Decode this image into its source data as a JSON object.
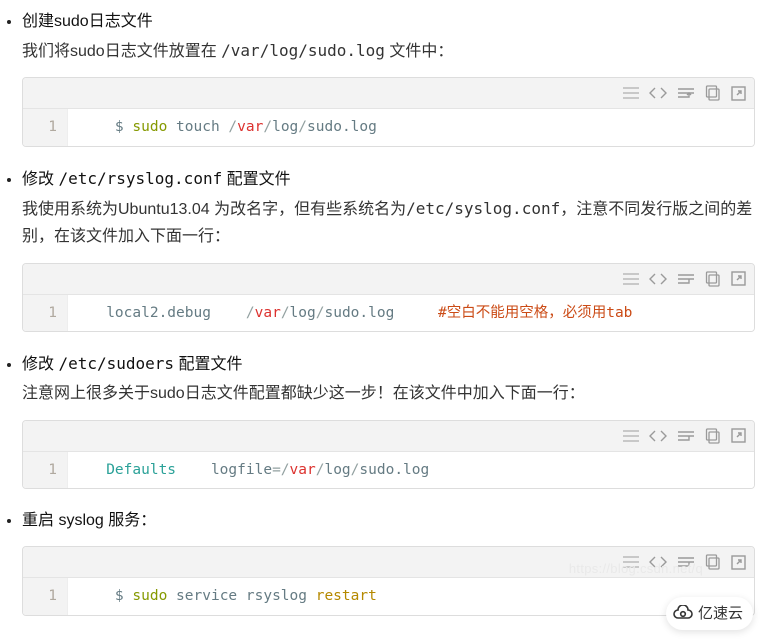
{
  "sections": [
    {
      "title": "创建sudo日志文件",
      "body_parts": [
        "我们将sudo日志文件放置在 ",
        "/var/log/sudo.log",
        " 文件中："
      ],
      "code": {
        "line_no": "1",
        "tokens": [
          {
            "t": "    $ ",
            "c": "c-default"
          },
          {
            "t": "sudo",
            "c": "c-green"
          },
          {
            "t": " touch ",
            "c": "c-default"
          },
          {
            "t": "/",
            "c": "c-dim"
          },
          {
            "t": "var",
            "c": "c-red"
          },
          {
            "t": "/",
            "c": "c-dim"
          },
          {
            "t": "log",
            "c": "c-default"
          },
          {
            "t": "/",
            "c": "c-dim"
          },
          {
            "t": "sudo.log",
            "c": "c-default"
          }
        ]
      }
    },
    {
      "title_parts": [
        "修改 ",
        "/etc/rsyslog.conf",
        " 配置文件"
      ],
      "body_parts": [
        "我使用系统为Ubuntu13.04 为改名字，但有些系统名为",
        "/etc/syslog.conf",
        "，注意不同发行版之间的差别，在该文件加入下面一行："
      ],
      "code": {
        "line_no": "1",
        "tokens": [
          {
            "t": "   local2.debug    ",
            "c": "c-default"
          },
          {
            "t": "/",
            "c": "c-dim"
          },
          {
            "t": "var",
            "c": "c-red"
          },
          {
            "t": "/",
            "c": "c-dim"
          },
          {
            "t": "log",
            "c": "c-default"
          },
          {
            "t": "/",
            "c": "c-dim"
          },
          {
            "t": "sudo.log     ",
            "c": "c-default"
          },
          {
            "t": "#空白不能用空格，必须用tab",
            "c": "c-brown"
          }
        ]
      }
    },
    {
      "title_parts": [
        "修改 ",
        "/etc/sudoers",
        " 配置文件"
      ],
      "body": "注意网上很多关于sudo日志文件配置都缺少这一步！在该文件中加入下面一行：",
      "code": {
        "line_no": "1",
        "tokens": [
          {
            "t": "   Defaults    ",
            "c": "c-cyan"
          },
          {
            "t": "logfile",
            "c": "c-default"
          },
          {
            "t": "=",
            "c": "c-dim"
          },
          {
            "t": "/",
            "c": "c-dim"
          },
          {
            "t": "var",
            "c": "c-red"
          },
          {
            "t": "/",
            "c": "c-dim"
          },
          {
            "t": "log",
            "c": "c-default"
          },
          {
            "t": "/",
            "c": "c-dim"
          },
          {
            "t": "sudo.log",
            "c": "c-default"
          }
        ]
      }
    },
    {
      "title": "重启 syslog 服务：",
      "body": "",
      "code": {
        "line_no": "1",
        "tokens": [
          {
            "t": "    $ ",
            "c": "c-default"
          },
          {
            "t": "sudo",
            "c": "c-green"
          },
          {
            "t": " service rsyslog ",
            "c": "c-default"
          },
          {
            "t": "restart",
            "c": "c-orange"
          }
        ]
      }
    }
  ],
  "toolbar_icons": [
    "list-icon",
    "code-icon",
    "wrap-icon",
    "copy-icon",
    "expand-icon"
  ],
  "watermark": "亿速云",
  "faint_url": "https://blog.csdn.net/q"
}
